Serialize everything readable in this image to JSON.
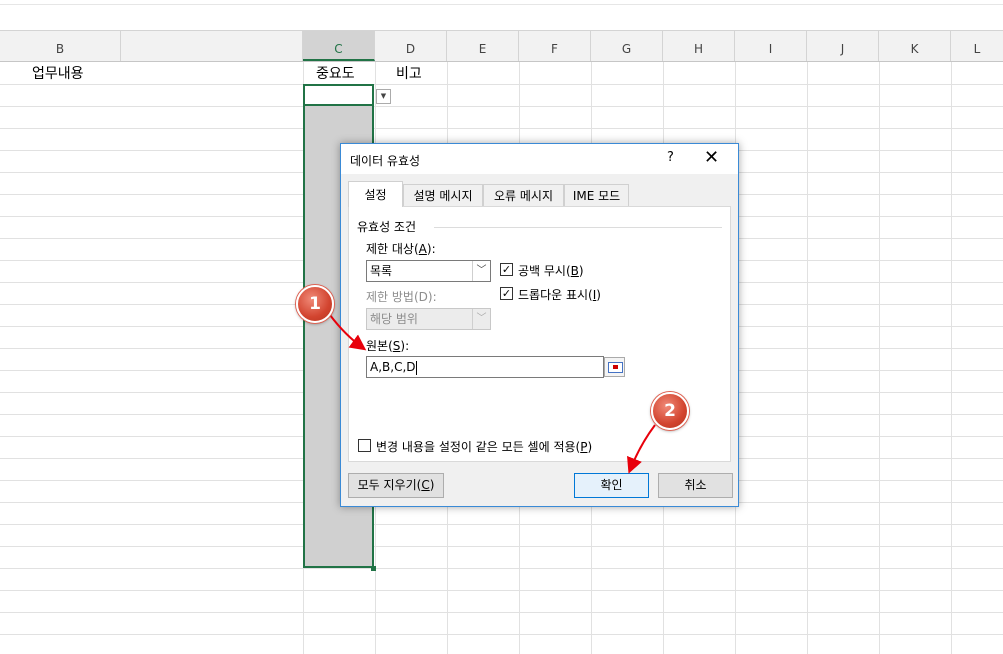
{
  "columns": [
    "B",
    "C",
    "D",
    "E",
    "F",
    "G",
    "H",
    "I",
    "J",
    "K",
    "L"
  ],
  "selected_column": "C",
  "cells": {
    "B1": "업무내용",
    "C1": "중요도",
    "D1": "비고"
  },
  "dialog": {
    "title": "데이터 유효성",
    "help": "?",
    "close": "✕",
    "tabs": [
      "설정",
      "설명 메시지",
      "오류 메시지",
      "IME 모드"
    ],
    "active_tab": "설정",
    "group_label": "유효성 조건",
    "allow_label": "제한 대상(",
    "allow_key": "A",
    "allow_suffix": "):",
    "allow_value": "목록",
    "data_label": "제한 방법(D):",
    "data_value": "해당 범위",
    "ignore_blank_label": "공백 무시(",
    "ignore_blank_key": "B",
    "ignore_blank_checked": true,
    "in_cell_dropdown_label": "드롭다운 표시(",
    "in_cell_dropdown_key": "I",
    "in_cell_dropdown_checked": true,
    "source_label": "원본(",
    "source_key": "S",
    "source_suffix": "):",
    "source_value": "A,B,C,D",
    "apply_all_label": "변경 내용을 설정이 같은 모든 셀에 적용(",
    "apply_all_key": "P",
    "apply_all_checked": false,
    "clear_all_label": "모두 지우기(",
    "clear_all_key": "C",
    "ok_label": "확인",
    "cancel_label": "취소",
    "close_paren": ")"
  },
  "annotations": {
    "badge1": "1",
    "badge2": "2",
    "color": "#d2442f",
    "arrow_color": "#e8000b"
  },
  "icons": {
    "dropdown": "chevron-down-icon",
    "checkbox": "checkmark-icon",
    "range_select": "collapse-dialog-icon"
  }
}
